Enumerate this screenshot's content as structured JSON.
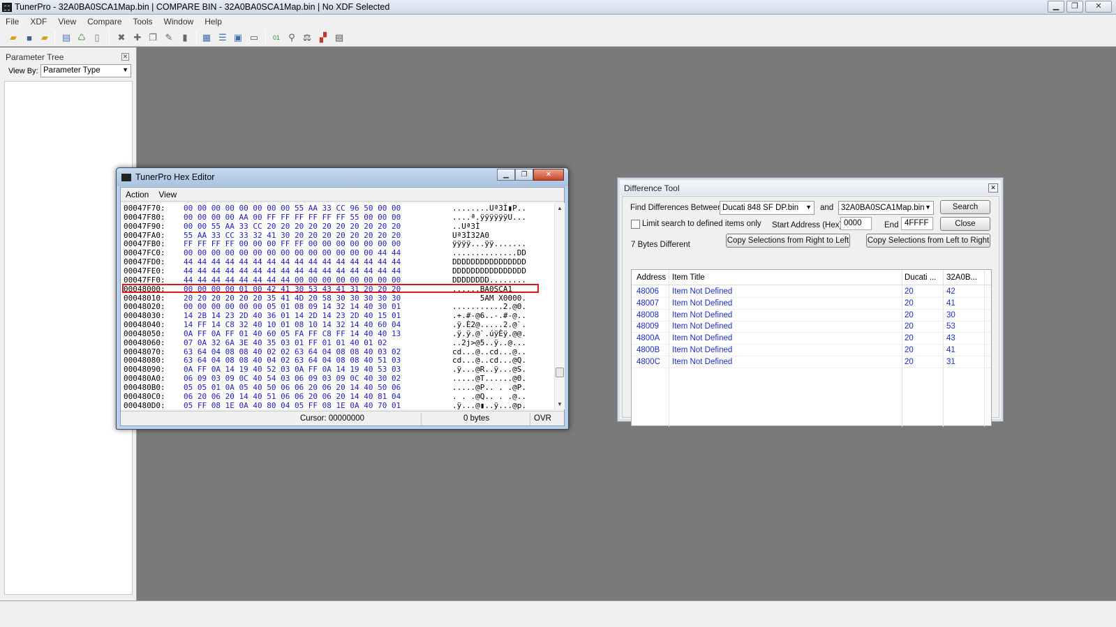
{
  "app": {
    "title": "TunerPro - 32A0BA0SCA1Map.bin | COMPARE BIN - 32A0BA0SCA1Map.bin | No XDF Selected",
    "menu": [
      "File",
      "XDF",
      "View",
      "Compare",
      "Tools",
      "Window",
      "Help"
    ],
    "toolbar_icons": [
      "open-folder-icon",
      "save-icon",
      "open-bin-icon",
      "import-icon",
      "export-icon",
      "new-doc-icon",
      "close-x-icon",
      "add-icon",
      "copy-icon",
      "wrench-icon",
      "doc-icon",
      "table-view-icon",
      "list-view-icon",
      "calendar-icon",
      "monitor-icon",
      "binary-icon",
      "search-icon",
      "balance-icon",
      "compare-icon",
      "calculator-icon"
    ]
  },
  "param_tree": {
    "title": "Parameter Tree",
    "view_by_label": "View By:",
    "view_by_value": "Parameter Type"
  },
  "hex_editor": {
    "title": "TunerPro Hex Editor",
    "menu": [
      "Action",
      "View"
    ],
    "rows": [
      {
        "addr": "00047F70:",
        "bytes": "00 00 00 00 00 00 00 00 55 AA 33 CC 96 50 00 00",
        "ascii": "........Uª3Ì▮P.."
      },
      {
        "addr": "00047F80:",
        "bytes": "00 00 00 00 AA 00 FF FF FF FF FF FF 55 00 00 00",
        "ascii": "....ª.ÿÿÿÿÿÿU..."
      },
      {
        "addr": "00047F90:",
        "bytes": "00 00 55 AA 33 CC 20 20 20 20 20 20 20 20 20 20",
        "ascii": "..Uª3Ì"
      },
      {
        "addr": "00047FA0:",
        "bytes": "55 AA 33 CC 33 32 41 30 20 20 20 20 20 20 20 20",
        "ascii": "Uª3Ì32A0"
      },
      {
        "addr": "00047FB0:",
        "bytes": "FF FF FF FF 00 00 00 FF FF 00 00 00 00 00 00 00",
        "ascii": "ÿÿÿÿ...ÿÿ......."
      },
      {
        "addr": "00047FC0:",
        "bytes": "00 00 00 00 00 00 00 00 00 00 00 00 00 00 44 44",
        "ascii": "..............DD"
      },
      {
        "addr": "00047FD0:",
        "bytes": "44 44 44 44 44 44 44 44 44 44 44 44 44 44 44 44",
        "ascii": "DDDDDDDDDDDDDDDD"
      },
      {
        "addr": "00047FE0:",
        "bytes": "44 44 44 44 44 44 44 44 44 44 44 44 44 44 44 44",
        "ascii": "DDDDDDDDDDDDDDDD"
      },
      {
        "addr": "00047FF0:",
        "bytes": "44 44 44 44 44 44 44 44 00 00 00 00 00 00 00 00",
        "ascii": "DDDDDDDD........"
      },
      {
        "addr": "00048000:",
        "bytes": "00 00 00 00 01 00 42 41 30 53 43 41 31 20 20 20",
        "ascii": "......BA0SCA1"
      },
      {
        "addr": "00048010:",
        "bytes": "20 20 20 20 20 20 35 41 4D 20 58 30 30 30 30 30",
        "ascii": "      5AM X0000."
      },
      {
        "addr": "00048020:",
        "bytes": "00 00 00 00 00 00 05 01 08 09 14 32 14 40 30 01",
        "ascii": "...........2.@0."
      },
      {
        "addr": "00048030:",
        "bytes": "14 2B 14 23 2D 40 36 01 14 2D 14 23 2D 40 15 01",
        "ascii": ".+.#-@6..-.#-@.."
      },
      {
        "addr": "00048040:",
        "bytes": "14 FF 14 C8 32 40 10 01 08 10 14 32 14 40 60 04",
        "ascii": ".ÿ.È2@.....2.@`."
      },
      {
        "addr": "00048050:",
        "bytes": "0A FF 0A FF 01 40 60 05 FA FF C8 FF 14 40 40 13",
        "ascii": ".ÿ.ÿ.@`.úÿÈÿ.@@."
      },
      {
        "addr": "00048060:",
        "bytes": "07 0A 32 6A 3E 40 35 03 01 FF 01 01 40 01 02",
        "ascii": "..2j>@5..ÿ..@..."
      },
      {
        "addr": "00048070:",
        "bytes": "63 64 04 08 08 40 02 02 63 64 04 08 08 40 03 02",
        "ascii": "cd...@..cd...@.."
      },
      {
        "addr": "00048080:",
        "bytes": "63 64 04 08 08 40 04 02 63 64 04 08 08 40 51 03",
        "ascii": "cd...@..cd...@Q."
      },
      {
        "addr": "00048090:",
        "bytes": "0A FF 0A 14 19 40 52 03 0A FF 0A 14 19 40 53 03",
        "ascii": ".ÿ...@R..ÿ...@S."
      },
      {
        "addr": "000480A0:",
        "bytes": "06 09 03 09 0C 40 54 03 06 09 03 09 0C 40 30 02",
        "ascii": ".....@T......@0."
      },
      {
        "addr": "000480B0:",
        "bytes": "05 05 01 0A 05 40 50 06 06 20 06 20 14 40 50 06",
        "ascii": ".....@P.. . .@P."
      },
      {
        "addr": "000480C0:",
        "bytes": "06 20 06 20 14 40 51 06 06 20 06 20 14 40 81 04",
        "ascii": ". . .@Q.. . .@.."
      },
      {
        "addr": "000480D0:",
        "bytes": "05 FF 08 1E 0A 40 80 04 05 FF 08 1E 0A 40 70 01",
        "ascii": ".ÿ...@▮..ÿ...@p."
      }
    ],
    "highlighted_row": 9,
    "status": {
      "cursor": "Cursor: 00000000",
      "bytes": "0 bytes",
      "mode": "OVR"
    }
  },
  "diff_tool": {
    "title": "Difference Tool",
    "find_label": "Find Differences Between",
    "file_a": "Ducati 848 SF DP.bin",
    "and_label": "and",
    "file_b": "32A0BA0SCA1Map.bin",
    "search_button": "Search",
    "close_button": "Close",
    "limit_label": "Limit search to defined items only",
    "start_label": "Start Address (Hex)",
    "start_value": "0000",
    "end_label": "End",
    "end_value": "4FFFF",
    "summary": "7 Bytes Different",
    "copy_rtl": "Copy Selections from Right to Left",
    "copy_ltr": "Copy Selections from Left to Right",
    "columns": [
      "Address",
      "Item Title",
      "Ducati ...",
      "32A0B..."
    ],
    "rows": [
      {
        "address": "48006",
        "title": "Item Not Defined",
        "a": "20",
        "b": "42"
      },
      {
        "address": "48007",
        "title": "Item Not Defined",
        "a": "20",
        "b": "41"
      },
      {
        "address": "48008",
        "title": "Item Not Defined",
        "a": "20",
        "b": "30"
      },
      {
        "address": "48009",
        "title": "Item Not Defined",
        "a": "20",
        "b": "53"
      },
      {
        "address": "4800A",
        "title": "Item Not Defined",
        "a": "20",
        "b": "43"
      },
      {
        "address": "4800B",
        "title": "Item Not Defined",
        "a": "20",
        "b": "41"
      },
      {
        "address": "4800C",
        "title": "Item Not Defined",
        "a": "20",
        "b": "31"
      }
    ]
  }
}
